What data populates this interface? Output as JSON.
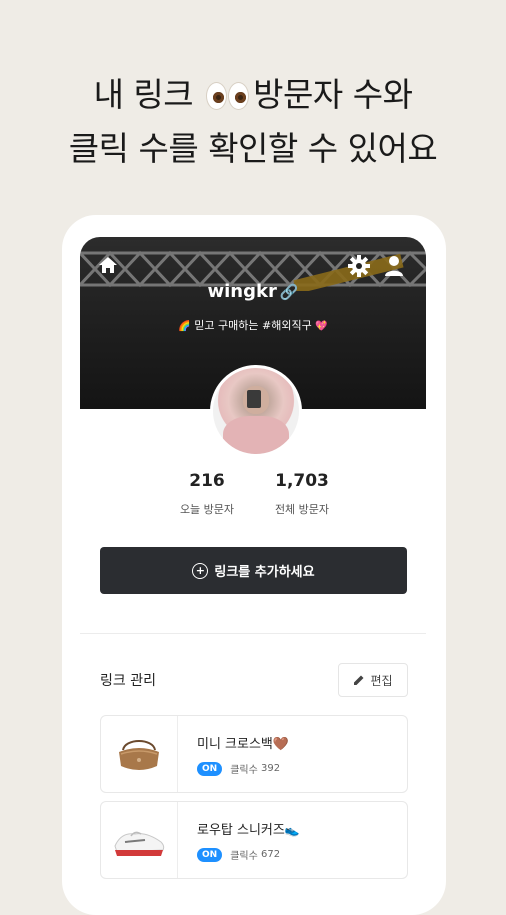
{
  "headline": {
    "line1_before": "내 링크",
    "line1_after": "방문자 수와",
    "line2": "클릭 수를 확인할 수 있어요"
  },
  "profile": {
    "username": "wingkr",
    "bio_prefix_emoji": "🌈",
    "bio": "믿고 구매하는 #해외직구",
    "bio_suffix_emoji": "💖"
  },
  "stats": {
    "today": {
      "value": "216",
      "label": "오늘 방문자"
    },
    "total": {
      "value": "1,703",
      "label": "전체 방문자"
    }
  },
  "add_link_button": {
    "label": "링크를 추가하세요"
  },
  "link_management": {
    "title": "링크 관리",
    "edit_label": "편집",
    "items": [
      {
        "title": "미니 크로스백",
        "emoji": "🤎",
        "status": "ON",
        "clicks_label": "클릭수",
        "clicks": "392"
      },
      {
        "title": "로우탑 스니커즈",
        "emoji": "👟",
        "status": "ON",
        "clicks_label": "클릭수",
        "clicks": "672"
      }
    ]
  },
  "colors": {
    "background": "#efece6",
    "button_dark": "#2b2d31",
    "on_badge": "#1e90ff"
  }
}
